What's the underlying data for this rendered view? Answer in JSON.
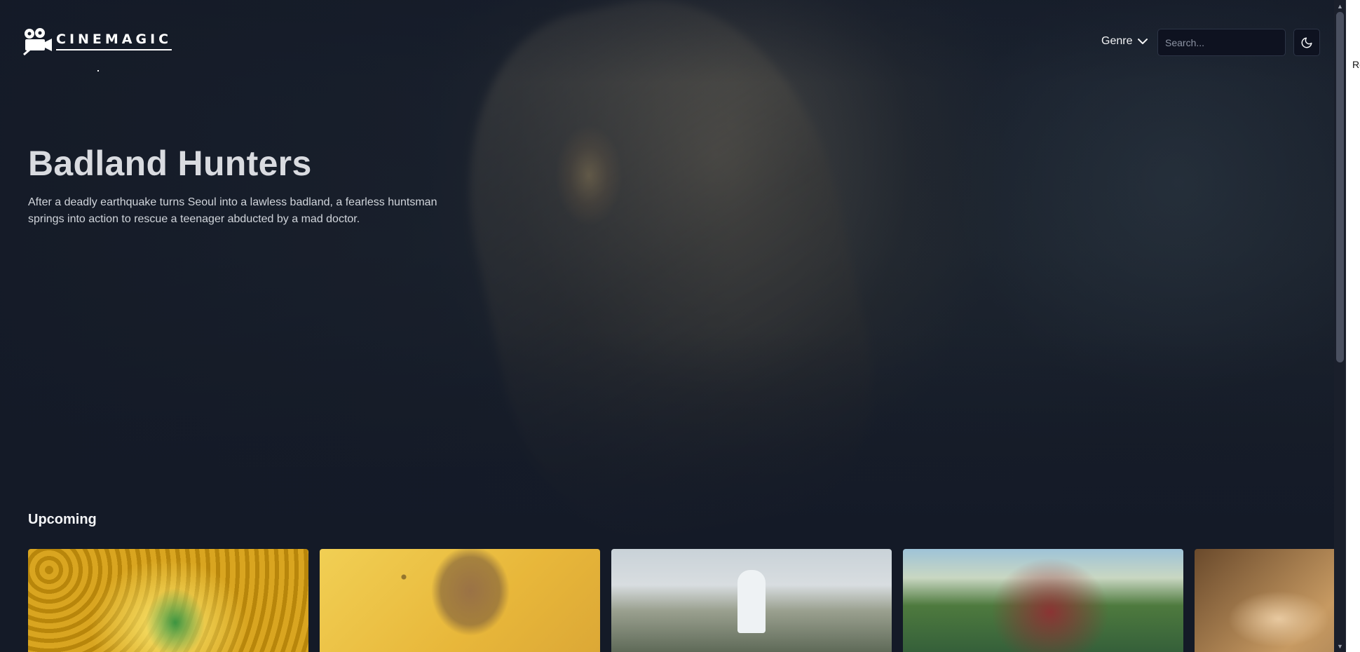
{
  "header": {
    "logo_text": "CINEMAGIC",
    "genre_label": "Genre",
    "search_placeholder": "Search..."
  },
  "hero": {
    "title": "Badland Hunters",
    "description": "After a deadly earthquake turns Seoul into a lawless badland, a fearless huntsman springs into action to rescue a teenager abducted by a mad doctor."
  },
  "upcoming": {
    "title": "Upcoming",
    "cards": [
      {
        "name": "upcoming-card-1"
      },
      {
        "name": "upcoming-card-2"
      },
      {
        "name": "upcoming-card-3"
      },
      {
        "name": "upcoming-card-4"
      },
      {
        "name": "upcoming-card-5"
      }
    ]
  },
  "edge": {
    "partial_text": "Re"
  },
  "colors": {
    "background": "#141a27",
    "search_bg": "#0e1220",
    "text_primary": "#f3f4f6"
  },
  "icons": [
    "film-camera-icon",
    "chevron-down-icon",
    "moon-icon"
  ]
}
